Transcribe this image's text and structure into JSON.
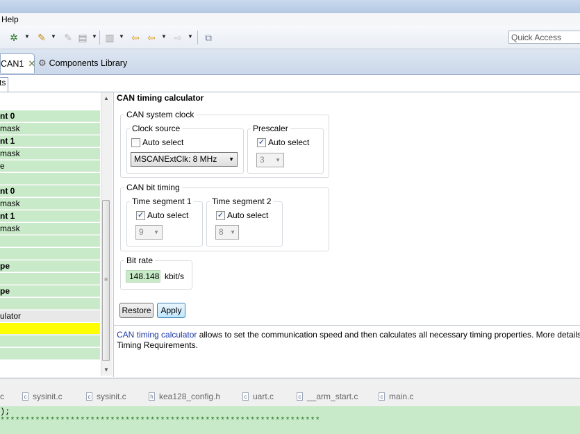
{
  "menubar": {
    "help": "Help"
  },
  "toolbar": {
    "quick_access_placeholder": "Quick Access"
  },
  "editor_tabs": [
    {
      "label": "CAN1"
    },
    {
      "label": "Components Library"
    }
  ],
  "subtab": {
    "label": "ts"
  },
  "left_rows": [
    {
      "text": "nt 0",
      "style": "bold"
    },
    {
      "text": "mask",
      "style": ""
    },
    {
      "text": "nt 1",
      "style": "bold"
    },
    {
      "text": "mask",
      "style": ""
    },
    {
      "text": "e",
      "style": ""
    },
    {
      "text": "",
      "style": ""
    },
    {
      "text": "nt 0",
      "style": "bold"
    },
    {
      "text": "mask",
      "style": ""
    },
    {
      "text": "nt 1",
      "style": "bold"
    },
    {
      "text": "mask",
      "style": ""
    },
    {
      "text": "",
      "style": ""
    },
    {
      "text": "",
      "style": ""
    },
    {
      "text": "pe",
      "style": "bold"
    },
    {
      "text": "",
      "style": ""
    },
    {
      "text": "pe",
      "style": "bold"
    },
    {
      "text": "",
      "style": ""
    },
    {
      "text": "ulator",
      "style": "gray"
    },
    {
      "text": "",
      "style": "yellow"
    },
    {
      "text": "",
      "style": ""
    },
    {
      "text": "",
      "style": ""
    }
  ],
  "calculator": {
    "title": "CAN timing calculator",
    "system_clock": {
      "label": "CAN system clock",
      "clock_source": {
        "label": "Clock source",
        "auto_select": "Auto select",
        "auto_checked": false,
        "value": "MSCANExtClk: 8 MHz"
      },
      "prescaler": {
        "label": "Prescaler",
        "auto_select": "Auto select",
        "auto_checked": true,
        "value": "3"
      }
    },
    "bit_timing": {
      "label": "CAN bit timing",
      "seg1": {
        "label": "Time segment 1",
        "auto_select": "Auto select",
        "auto_checked": true,
        "value": "9"
      },
      "seg2": {
        "label": "Time segment 2",
        "auto_select": "Auto select",
        "auto_checked": true,
        "value": "8"
      }
    },
    "bit_rate": {
      "label": "Bit rate",
      "value": "148.148",
      "unit": "kbit/s"
    },
    "restore": "Restore",
    "apply": "Apply"
  },
  "info": {
    "link": "CAN timing calculator",
    "text": " allows to set the communication speed and then calculates all necessary timing properties. More details",
    "line2": "Timing Requirements."
  },
  "file_tabs": [
    {
      "name": "c",
      "icon": ""
    },
    {
      "name": "sysinit.c",
      "icon": "c"
    },
    {
      "name": "sysinit.c",
      "icon": "c"
    },
    {
      "name": "kea128_config.h",
      "icon": "h"
    },
    {
      "name": "uart.c",
      "icon": "c"
    },
    {
      "name": "__arm_start.c",
      "icon": "c"
    },
    {
      "name": "main.c",
      "icon": "c"
    }
  ],
  "console": {
    "line1": ");",
    "line2": "****************************************************************"
  },
  "colors": {
    "green_row": "#c8eac8",
    "highlight": "#ffff00",
    "link": "#1a37a7"
  }
}
